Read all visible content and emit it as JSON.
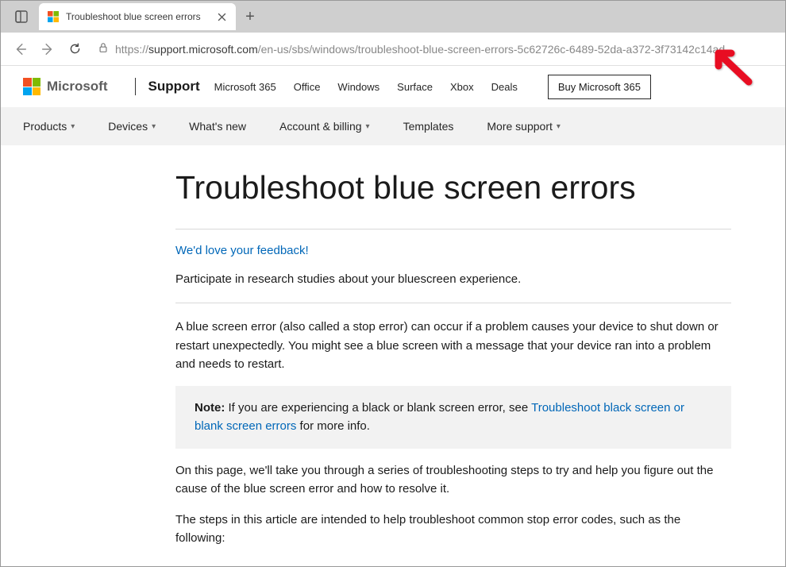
{
  "browser": {
    "tab_title": "Troubleshoot blue screen errors",
    "url_prefix": "https://",
    "url_host": "support.microsoft.com",
    "url_path": "/en-us/sbs/windows/troubleshoot-blue-screen-errors-5c62726c-6489-52da-a372-3f73142c14ad"
  },
  "header": {
    "brand": "Microsoft",
    "support": "Support",
    "nav": [
      "Microsoft 365",
      "Office",
      "Windows",
      "Surface",
      "Xbox",
      "Deals"
    ],
    "buy": "Buy Microsoft 365"
  },
  "subnav": {
    "products": "Products",
    "devices": "Devices",
    "whatsnew": "What's new",
    "account": "Account & billing",
    "templates": "Templates",
    "moresupport": "More support"
  },
  "page": {
    "title": "Troubleshoot blue screen errors",
    "feedback_link": "We'd love your feedback!",
    "feedback_text": "Participate in research studies about your bluescreen experience.",
    "intro": "A blue screen error (also called a stop error) can occur if a problem causes your device to shut down or restart unexpectedly. You might see a blue screen with a message that your device ran into a problem and needs to restart.",
    "note_label": "Note:",
    "note_before": " If you are experiencing a black or blank screen error, see ",
    "note_link": "Troubleshoot black screen or blank screen errors",
    "note_after": " for more info.",
    "para2": "On this page, we'll take you through a series of troubleshooting steps to try and help you figure out the cause of the blue screen error and how to resolve it.",
    "para3": "The steps in this article are intended to help troubleshoot common stop error codes, such as the following:"
  }
}
